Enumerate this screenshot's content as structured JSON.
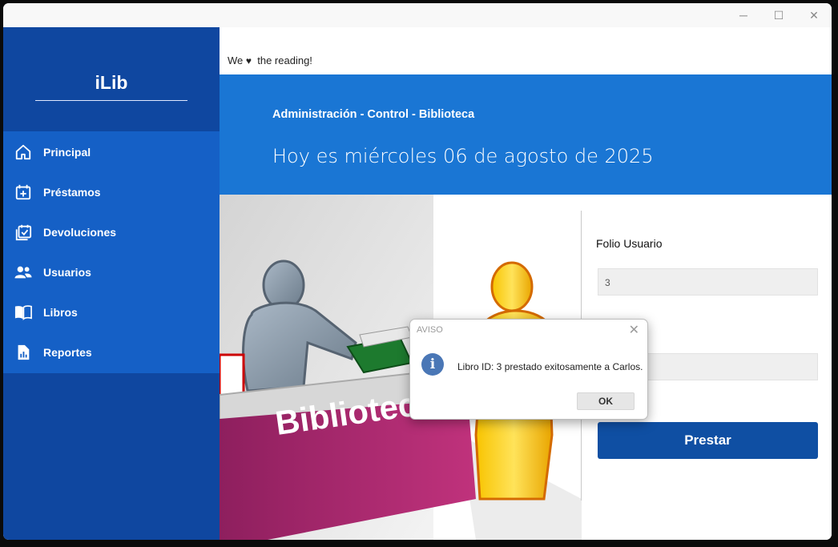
{
  "window": {
    "controls": {
      "minimize": "─",
      "maximize": "☐",
      "close": "✕"
    }
  },
  "sidebar": {
    "brand": "iLib",
    "items": [
      {
        "label": "Principal",
        "icon": "home-icon"
      },
      {
        "label": "Préstamos",
        "icon": "calendar-plus-icon"
      },
      {
        "label": "Devoluciones",
        "icon": "calendar-check-icon"
      },
      {
        "label": "Usuarios",
        "icon": "users-icon"
      },
      {
        "label": "Libros",
        "icon": "book-open-icon"
      },
      {
        "label": "Reportes",
        "icon": "report-icon"
      }
    ]
  },
  "header": {
    "tagline_pre": "We",
    "tagline_post": "the reading!",
    "subtitle": "Administración - Control - Biblioteca",
    "date": "Hoy es miércoles 06 de agosto de 2025"
  },
  "illustration": {
    "desk_text": "Biblioteca"
  },
  "form": {
    "folio_label": "Folio Usuario",
    "folio_value": "3",
    "second_value": "",
    "submit_label": "Prestar"
  },
  "dialog": {
    "title": "AVISO",
    "close": "✕",
    "message": "Libro ID: 3 prestado exitosamente a Carlos.",
    "ok_label": "OK",
    "icon": "info-icon"
  },
  "colors": {
    "sidebar_dark": "#0f47a0",
    "sidebar_menu": "#1560c6",
    "banner": "#1a76d4",
    "button": "#0f4fa3"
  }
}
